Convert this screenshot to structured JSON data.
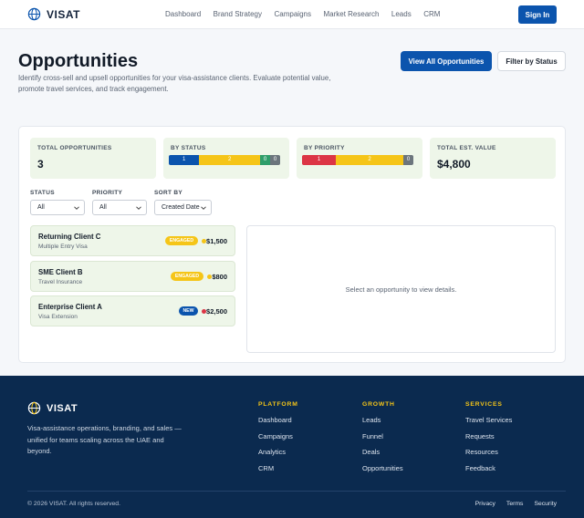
{
  "header": {
    "brand": "VISAT",
    "nav": [
      "Dashboard",
      "Brand Strategy",
      "Campaigns",
      "Market Research",
      "Leads",
      "CRM"
    ],
    "signin_label": "Sign In"
  },
  "hero": {
    "title": "Opportunities",
    "description": "Identify cross-sell and upsell opportunities for your visa-assistance clients. Evaluate potential value, promote travel services, and track engagement.",
    "primary_button": "View All Opportunities",
    "secondary_button": "Filter by Status"
  },
  "stats": {
    "total": {
      "label": "TOTAL OPPORTUNITIES",
      "value": "3"
    },
    "by_status": {
      "label": "BY STATUS",
      "segments": [
        {
          "value": "1",
          "count": 1,
          "color": "#0b54ad"
        },
        {
          "value": "2",
          "count": 2,
          "color": "#f5c518"
        },
        {
          "value": "0",
          "count": 0,
          "color": "#2e9e6a"
        },
        {
          "value": "0",
          "count": 0,
          "color": "#6c757d"
        }
      ]
    },
    "by_priority": {
      "label": "BY PRIORITY",
      "segments": [
        {
          "value": "1",
          "count": 1,
          "color": "#dc3545"
        },
        {
          "value": "2",
          "count": 2,
          "color": "#f5c518"
        },
        {
          "value": "0",
          "count": 0,
          "color": "#6c757d"
        }
      ]
    },
    "est_value": {
      "label": "TOTAL EST. VALUE",
      "value": "$4,800"
    }
  },
  "filters": {
    "status": {
      "label": "STATUS",
      "selected": "All"
    },
    "priority": {
      "label": "PRIORITY",
      "selected": "All"
    },
    "sort": {
      "label": "SORT BY",
      "selected": "Created Date"
    }
  },
  "opportunities": [
    {
      "name": "Returning Client C",
      "service": "Multiple Entry Visa",
      "status": "ENGAGED",
      "status_bg": "#f5c518",
      "status_fg": "#ffffff",
      "priority_color": "#f5c518",
      "amount": "$1,500"
    },
    {
      "name": "SME Client B",
      "service": "Travel Insurance",
      "status": "ENGAGED",
      "status_bg": "#f5c518",
      "status_fg": "#ffffff",
      "priority_color": "#f5c518",
      "amount": "$800"
    },
    {
      "name": "Enterprise Client A",
      "service": "Visa Extension",
      "status": "NEW",
      "status_bg": "#0b54ad",
      "status_fg": "#ffffff",
      "priority_color": "#dc3545",
      "amount": "$2,500"
    }
  ],
  "detail": {
    "empty_text": "Select an opportunity to view details."
  },
  "footer": {
    "brand": "VISAT",
    "tagline": "Visa-assistance operations, branding, and sales — unified for teams scaling across the UAE and beyond.",
    "columns": [
      {
        "title": "PLATFORM",
        "links": [
          "Dashboard",
          "Campaigns",
          "Analytics",
          "CRM"
        ]
      },
      {
        "title": "GROWTH",
        "links": [
          "Leads",
          "Funnel",
          "Deals",
          "Opportunities"
        ]
      },
      {
        "title": "SERVICES",
        "links": [
          "Travel Services",
          "Requests",
          "Resources",
          "Feedback"
        ]
      }
    ],
    "copyright": "© 2026 VISAT. All rights reserved.",
    "legal": [
      "Privacy",
      "Terms",
      "Security"
    ]
  }
}
